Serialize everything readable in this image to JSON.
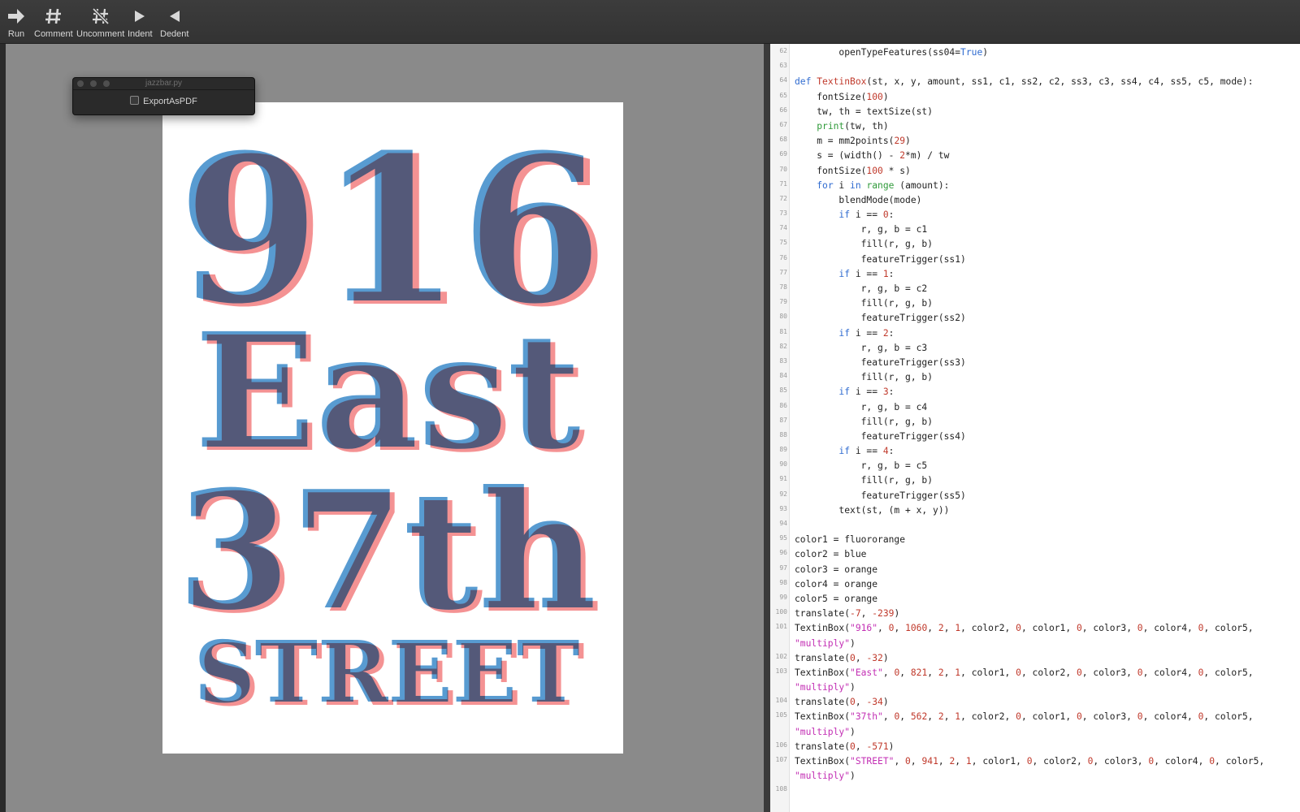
{
  "toolbar": {
    "buttons": [
      {
        "label": "Run",
        "icon": "arrow-right-icon"
      },
      {
        "label": "Comment",
        "icon": "hash-icon"
      },
      {
        "label": "Uncomment",
        "icon": "hash-slash-icon"
      },
      {
        "label": "Indent",
        "icon": "triangle-right-icon"
      },
      {
        "label": "Dedent",
        "icon": "triangle-left-icon"
      }
    ]
  },
  "palette": {
    "title": "jazzbar.py",
    "checkbox_label": "ExportAsPDF"
  },
  "poster": {
    "lines": [
      "916",
      "East",
      "37th",
      "STREET"
    ],
    "colors": {
      "pink": "#f4898a",
      "blue": "#3a89c9",
      "dark": "#2d4a6e"
    }
  },
  "editor": {
    "lines": [
      {
        "n": "62",
        "html": "        openTypeFeatures(ss04=<span class='tr'>True</span>)"
      },
      {
        "n": "63",
        "html": ""
      },
      {
        "n": "64",
        "html": "<span class='kw'>def</span> <span class='fn'>TextinBox</span>(st, x, y, amount, ss1, c1, ss2, c2, ss3, c3, ss4, c4, ss5, c5, mode):"
      },
      {
        "n": "65",
        "html": "    fontSize(<span class='num'>100</span>)"
      },
      {
        "n": "66",
        "html": "    tw, th = textSize(st)"
      },
      {
        "n": "67",
        "html": "    <span class='bi'>print</span>(tw, th)"
      },
      {
        "n": "68",
        "html": "    m = mm2points(<span class='num'>29</span>)"
      },
      {
        "n": "69",
        "html": "    s = (width() - <span class='num'>2</span>*m) / tw"
      },
      {
        "n": "70",
        "html": "    fontSize(<span class='num'>100</span> * s)"
      },
      {
        "n": "71",
        "html": "    <span class='kw'>for</span> i <span class='kw'>in</span> <span class='bi'>range</span> (amount):"
      },
      {
        "n": "72",
        "html": "        blendMode(mode)"
      },
      {
        "n": "73",
        "html": "        <span class='kw'>if</span> i == <span class='num'>0</span>:"
      },
      {
        "n": "74",
        "html": "            r, g, b = c1"
      },
      {
        "n": "75",
        "html": "            fill(r, g, b)"
      },
      {
        "n": "76",
        "html": "            featureTrigger(ss1)"
      },
      {
        "n": "77",
        "html": "        <span class='kw'>if</span> i == <span class='num'>1</span>:"
      },
      {
        "n": "78",
        "html": "            r, g, b = c2"
      },
      {
        "n": "79",
        "html": "            fill(r, g, b)"
      },
      {
        "n": "80",
        "html": "            featureTrigger(ss2)"
      },
      {
        "n": "81",
        "html": "        <span class='kw'>if</span> i == <span class='num'>2</span>:"
      },
      {
        "n": "82",
        "html": "            r, g, b = c3"
      },
      {
        "n": "83",
        "html": "            featureTrigger(ss3)"
      },
      {
        "n": "84",
        "html": "            fill(r, g, b)"
      },
      {
        "n": "85",
        "html": "        <span class='kw'>if</span> i == <span class='num'>3</span>:"
      },
      {
        "n": "86",
        "html": "            r, g, b = c4"
      },
      {
        "n": "87",
        "html": "            fill(r, g, b)"
      },
      {
        "n": "88",
        "html": "            featureTrigger(ss4)"
      },
      {
        "n": "89",
        "html": "        <span class='kw'>if</span> i == <span class='num'>4</span>:"
      },
      {
        "n": "90",
        "html": "            r, g, b = c5"
      },
      {
        "n": "91",
        "html": "            fill(r, g, b)"
      },
      {
        "n": "92",
        "html": "            featureTrigger(ss5)"
      },
      {
        "n": "93",
        "html": "        text(st, (m + x, y))"
      },
      {
        "n": "94",
        "html": ""
      },
      {
        "n": "95",
        "html": "color1 = fluororange"
      },
      {
        "n": "96",
        "html": "color2 = blue"
      },
      {
        "n": "97",
        "html": "color3 = orange"
      },
      {
        "n": "98",
        "html": "color4 = orange"
      },
      {
        "n": "99",
        "html": "color5 = orange"
      },
      {
        "n": "100",
        "html": "translate(<span class='num'>-7</span>, <span class='num'>-239</span>)"
      },
      {
        "n": "101",
        "html": "TextinBox(<span class='str'>\"916\"</span>, <span class='num'>0</span>, <span class='num'>1060</span>, <span class='num'>2</span>, <span class='num'>1</span>, color2, <span class='num'>0</span>, color1, <span class='num'>0</span>, color3, <span class='num'>0</span>, color4, <span class='num'>0</span>, color5,"
      },
      {
        "n": "",
        "html": "<span class='str'>\"multiply\"</span>)"
      },
      {
        "n": "102",
        "html": "translate(<span class='num'>0</span>, <span class='num'>-32</span>)"
      },
      {
        "n": "103",
        "html": "TextinBox(<span class='str'>\"East\"</span>, <span class='num'>0</span>, <span class='num'>821</span>, <span class='num'>2</span>, <span class='num'>1</span>, color1, <span class='num'>0</span>, color2, <span class='num'>0</span>, color3, <span class='num'>0</span>, color4, <span class='num'>0</span>, color5,"
      },
      {
        "n": "",
        "html": "<span class='str'>\"multiply\"</span>)"
      },
      {
        "n": "104",
        "html": "translate(<span class='num'>0</span>, <span class='num'>-34</span>)"
      },
      {
        "n": "105",
        "html": "TextinBox(<span class='str'>\"37th\"</span>, <span class='num'>0</span>, <span class='num'>562</span>, <span class='num'>2</span>, <span class='num'>1</span>, color2, <span class='num'>0</span>, color1, <span class='num'>0</span>, color3, <span class='num'>0</span>, color4, <span class='num'>0</span>, color5,"
      },
      {
        "n": "",
        "html": "<span class='str'>\"multiply\"</span>)"
      },
      {
        "n": "106",
        "html": "translate(<span class='num'>0</span>, <span class='num'>-571</span>)"
      },
      {
        "n": "107",
        "html": "TextinBox(<span class='str'>\"STREET\"</span>, <span class='num'>0</span>, <span class='num'>941</span>, <span class='num'>2</span>, <span class='num'>1</span>, color1, <span class='num'>0</span>, color2, <span class='num'>0</span>, color3, <span class='num'>0</span>, color4, <span class='num'>0</span>, color5,"
      },
      {
        "n": "",
        "html": "<span class='str'>\"multiply\"</span>)"
      },
      {
        "n": "108",
        "html": ""
      }
    ]
  }
}
